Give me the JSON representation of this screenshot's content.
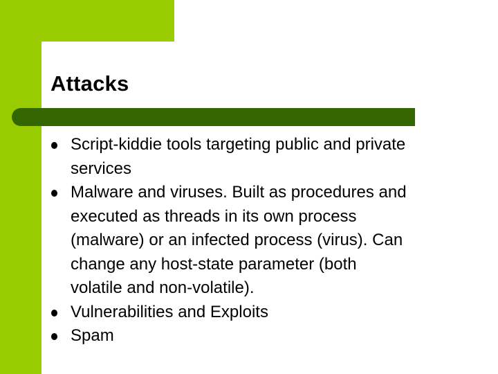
{
  "slide": {
    "title": "Attacks",
    "colors": {
      "accent_light": "#99cc00",
      "accent_dark": "#336600",
      "background": "#ffffff",
      "text": "#000000"
    },
    "bullets": [
      {
        "lines": [
          "Script-kiddie tools targeting public and private",
          "services"
        ]
      },
      {
        "lines": [
          "Malware and viruses. Built as procedures and",
          "executed as threads in its own process",
          "(malware) or an infected process (virus). Can",
          "change any host-state parameter (both",
          "volatile and non-volatile)."
        ]
      },
      {
        "lines": [
          "Vulnerabilities and Exploits"
        ]
      },
      {
        "lines": [
          "Spam"
        ]
      }
    ]
  }
}
